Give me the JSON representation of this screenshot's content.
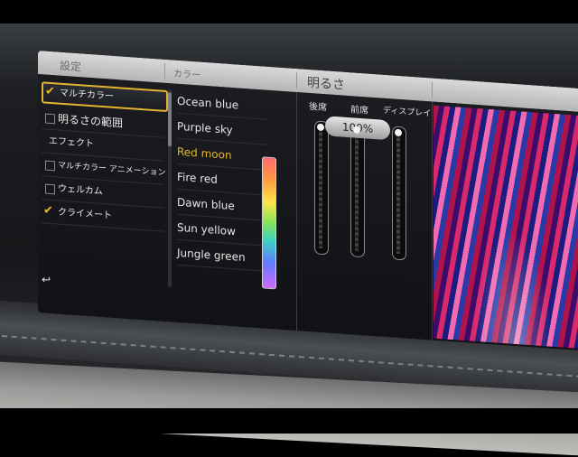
{
  "header": {
    "col1_title": "設定",
    "col2_title": "カラー",
    "col3_title": "明るさ"
  },
  "settings_list": {
    "items": [
      {
        "label": "マルチカラー",
        "checked": true,
        "selected": true
      },
      {
        "label": "明るさの範囲",
        "checked": false,
        "selected": false
      },
      {
        "label": "エフェクト",
        "checked": null,
        "selected": false
      },
      {
        "label": "マルチカラー アニメーション",
        "checked": false,
        "selected": false
      },
      {
        "label": "ウェルカム",
        "checked": false,
        "selected": false
      },
      {
        "label": "クライメート",
        "checked": true,
        "selected": false
      }
    ],
    "back_icon": "↩"
  },
  "color_list": {
    "items": [
      "Ocean blue",
      "Purple sky",
      "Red moon",
      "Fire red",
      "Dawn blue",
      "Sun yellow",
      "Jungle green"
    ],
    "active": "Red moon"
  },
  "brightness": {
    "labels": [
      "後席",
      "前席",
      "ディスプレイ"
    ],
    "value_text": "100%",
    "levels": [
      1.0,
      1.0,
      1.0
    ]
  },
  "colors": {
    "accent": "#e3b430",
    "active_text": "#e8b62a",
    "header_bg": "#c8c8c8",
    "panel_bg": "#14161a"
  },
  "icons": {
    "check": "check-icon",
    "back": "back-arrow-icon"
  }
}
